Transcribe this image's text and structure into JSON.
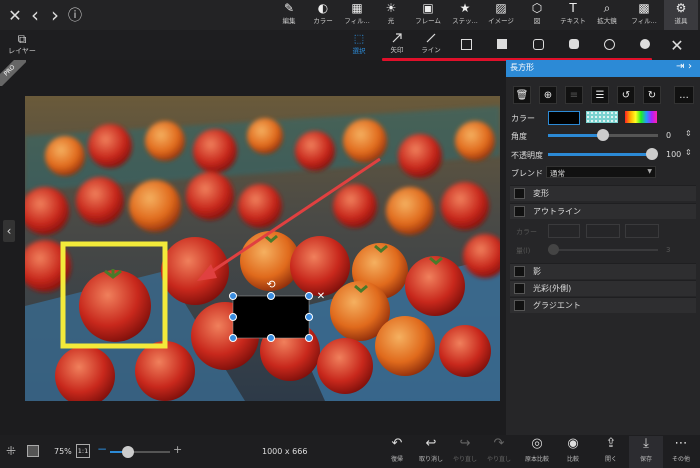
{
  "top_nav": {
    "close": "✕",
    "back": "‹",
    "forward": "›",
    "info": "ⓘ"
  },
  "tools": [
    {
      "label": "編集",
      "icon": "✎"
    },
    {
      "label": "カラー",
      "icon": "◐"
    },
    {
      "label": "フィル...",
      "icon": "▦"
    },
    {
      "label": "光",
      "icon": "☀"
    },
    {
      "label": "フレーム",
      "icon": "▣"
    },
    {
      "label": "ステッ...",
      "icon": "★"
    },
    {
      "label": "イメージ",
      "icon": "▨"
    },
    {
      "label": "図",
      "icon": "⬡"
    },
    {
      "label": "テキスト",
      "icon": "T"
    },
    {
      "label": "拡大鏡",
      "icon": "⌕"
    },
    {
      "label": "フィル...",
      "icon": "▩"
    },
    {
      "label": "道具",
      "icon": "⚙"
    }
  ],
  "layer_button": {
    "label": "レイヤー"
  },
  "pro_badge": "PRO",
  "secondary_tools": {
    "select": "選択",
    "arrow": "矢印",
    "line": "ライン"
  },
  "panel": {
    "title": "長方形",
    "more": "...",
    "color_label": "カラー",
    "angle_label": "角度",
    "angle_value": "0",
    "angle_fraction": 0.5,
    "opacity_label": "不透明度",
    "opacity_value": "100",
    "opacity_fraction": 1.0,
    "blend_label": "ブレンド",
    "blend_value": "通常",
    "sections": [
      "変形",
      "アウトライン",
      "影",
      "光彩(外側)",
      "グラジエント"
    ],
    "dim_color_label": "カラー",
    "dim_amount_label": "量(l)",
    "dim_value": "3"
  },
  "bottom": {
    "zoom": "75%",
    "ratio": "1:1",
    "minus": "−",
    "plus": "+",
    "zoom_fraction": 0.3,
    "size": "1000 x 666",
    "buttons": [
      "復帰",
      "取り消し",
      "やり直し",
      "やり直し",
      "原本比較",
      "比較",
      "開く",
      "保存",
      "その他"
    ]
  },
  "colors": {
    "accent": "#2c8ad6",
    "red_line": "#e0102a",
    "yellow_frame": "#f3ea3a"
  }
}
